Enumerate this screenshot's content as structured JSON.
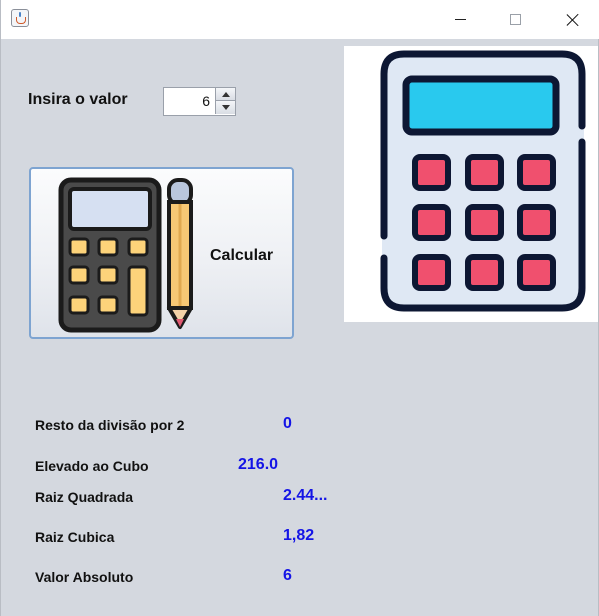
{
  "window": {
    "icon": "java-app-icon",
    "controls": [
      "minimize-icon",
      "maximize-icon",
      "close-icon"
    ]
  },
  "input": {
    "label": "Insira o valor",
    "value": "6"
  },
  "button": {
    "label": "Calcular",
    "icon": "calculator-pencil-icon"
  },
  "picture": {
    "icon": "calculator-icon"
  },
  "results": [
    {
      "label": "Resto da divisão por 2",
      "value": "0"
    },
    {
      "label": "Elevado ao Cubo",
      "value": "216.0"
    },
    {
      "label": "Raiz Quadrada",
      "value": "2.44..."
    },
    {
      "label": "Raiz Cubica",
      "value": "1,82"
    },
    {
      "label": "Valor Absoluto",
      "value": "6"
    }
  ],
  "colors": {
    "result_value": "#1414e6",
    "window_bg": "#d4d8df",
    "button_border": "#7ea4d1",
    "calc_screen": "#29c9ee",
    "calc_keys": "#f0506e",
    "calc_body": "#dfe8f4",
    "calc_outline": "#0d1733"
  }
}
